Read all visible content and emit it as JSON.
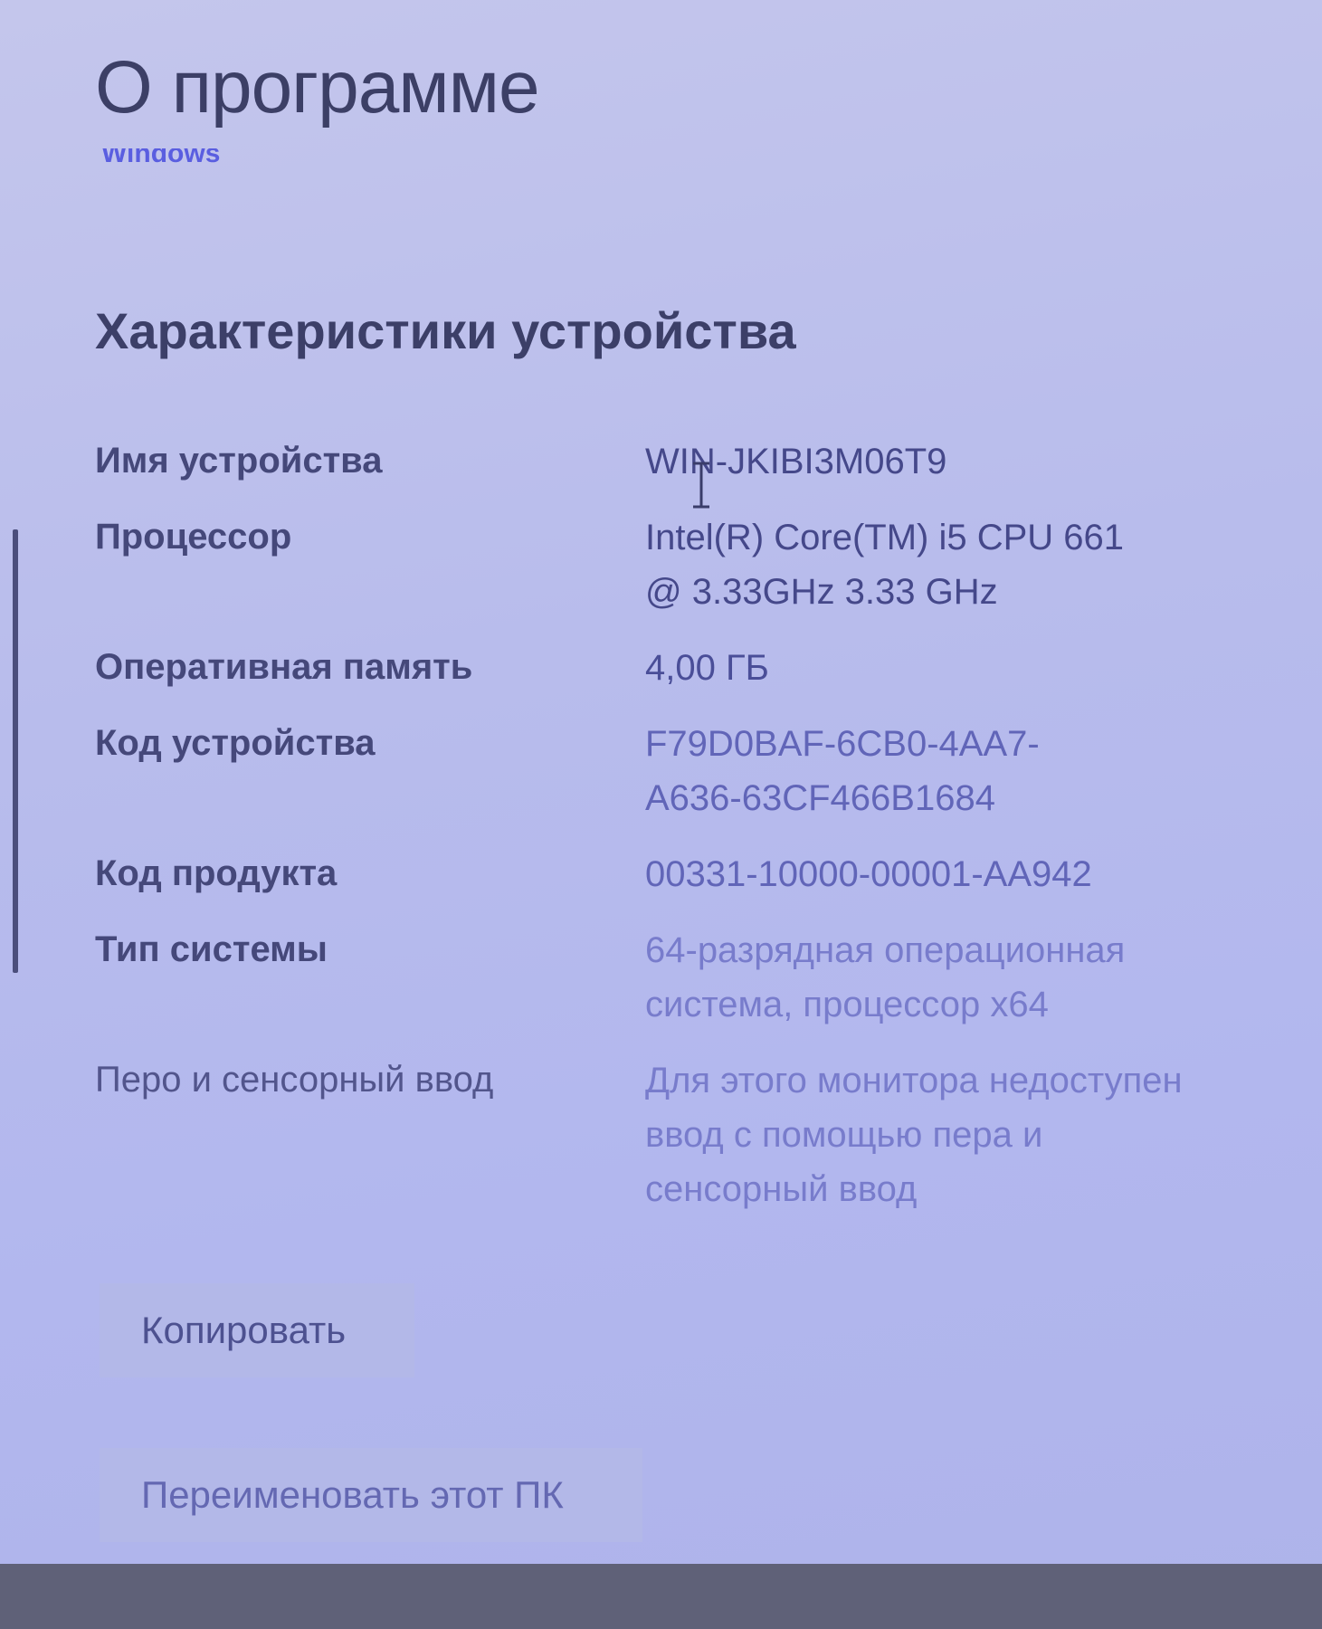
{
  "page": {
    "title": "О программе",
    "link_fragment": "Windows"
  },
  "device_specs": {
    "heading": "Характеристики устройства",
    "rows": [
      {
        "label": "Имя устройства",
        "value": "WIN-JKIBI3M06T9"
      },
      {
        "label": "Процессор",
        "value": "Intel(R) Core(TM) i5 CPU         661\n@ 3.33GHz   3.33 GHz"
      },
      {
        "label": "Оперативная память",
        "value": "4,00 ГБ"
      },
      {
        "label": "Код устройства",
        "value": "F79D0BAF-6CB0-4AA7-\nA636-63CF466B1684"
      },
      {
        "label": "Код продукта",
        "value": "00331-10000-00001-AA942"
      },
      {
        "label": "Тип системы",
        "value": "64-разрядная операционная\nсистема, процессор x64"
      },
      {
        "label": "Перо и сенсорный ввод",
        "value": "Для этого монитора недоступен\nввод с помощью пера и\nсенсорный ввод"
      }
    ]
  },
  "buttons": {
    "copy": "Копировать",
    "rename": "Переименовать этот ПК"
  },
  "colors": {
    "background": "#b8bcec",
    "text_primary": "#3c3f68",
    "value_text": "#575ba8",
    "button_bg": "#b3b8e8",
    "link": "#5a5ee0"
  },
  "icons": {
    "cursor": "text-ibeam-cursor"
  }
}
